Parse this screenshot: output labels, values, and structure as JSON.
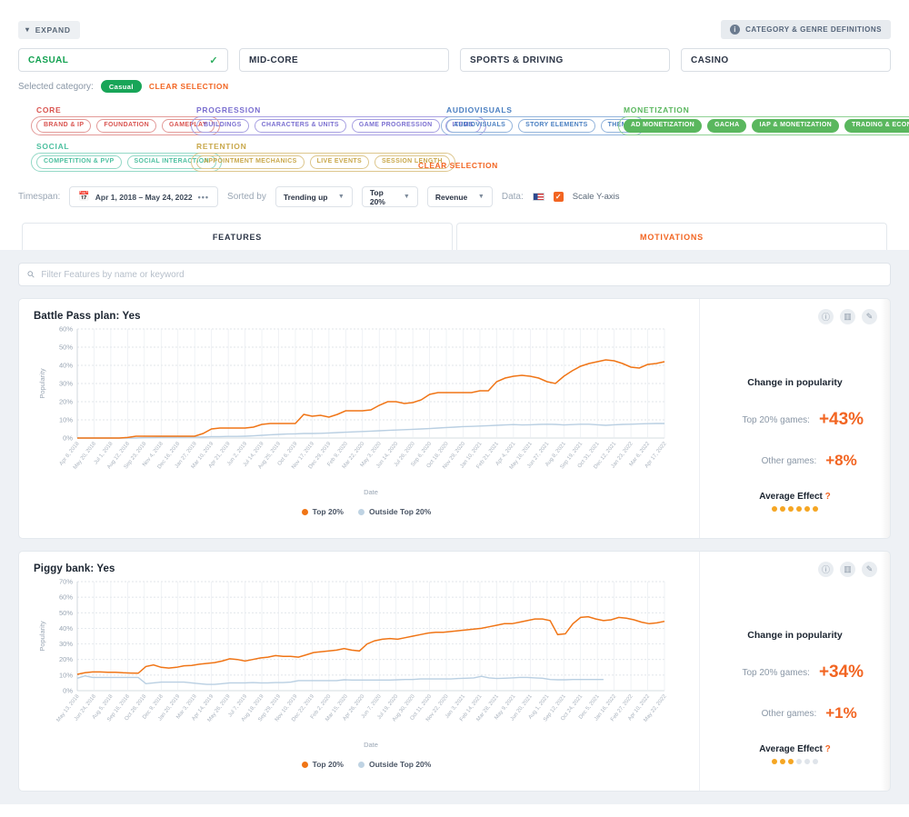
{
  "header": {
    "expand_label": "EXPAND",
    "definitions_label": "CATEGORY & GENRE DEFINITIONS",
    "info_icon": "info-icon",
    "chevron_icon": "chevron-down-icon"
  },
  "categories": [
    {
      "label": "CASUAL",
      "selected": true
    },
    {
      "label": "MID-CORE",
      "selected": false
    },
    {
      "label": "SPORTS & DRIVING",
      "selected": false
    },
    {
      "label": "CASINO",
      "selected": false
    }
  ],
  "selected_category": {
    "prefix": "Selected category:",
    "pill": "Casual",
    "clear": "CLEAR SELECTION"
  },
  "tag_groups": [
    {
      "title": "CORE",
      "color": "#d9534f",
      "klass": "g-core",
      "tags": [
        {
          "label": "BRAND & IP",
          "selected": false
        },
        {
          "label": "FOUNDATION",
          "selected": false
        },
        {
          "label": "GAMEPLAY",
          "selected": false
        }
      ]
    },
    {
      "title": "PROGRESSION",
      "color": "#7a6fd0",
      "klass": "g-prog",
      "tags": [
        {
          "label": "BUILDINGS",
          "selected": false
        },
        {
          "label": "CHARACTERS & UNITS",
          "selected": false
        },
        {
          "label": "GAME PROGRESSION",
          "selected": false
        },
        {
          "label": "ITEMS",
          "selected": false
        }
      ]
    },
    {
      "title": "AUDIOVISUALS",
      "color": "#4a7fc1",
      "klass": "g-av",
      "tags": [
        {
          "label": "AUDIOVISUALS",
          "selected": false
        },
        {
          "label": "STORY ELEMENTS",
          "selected": false
        },
        {
          "label": "THEME",
          "selected": false
        }
      ]
    },
    {
      "title": "MONETIZATION",
      "color": "#5ab75e",
      "klass": "g-mon",
      "tags": [
        {
          "label": "AD MONETIZATION",
          "selected": true
        },
        {
          "label": "GACHA",
          "selected": true
        },
        {
          "label": "IAP & MONETIZATION",
          "selected": true
        },
        {
          "label": "TRADING & ECONOMY",
          "selected": true
        }
      ]
    },
    {
      "title": "SOCIAL",
      "color": "#4ec0a0",
      "klass": "g-social",
      "tags": [
        {
          "label": "COMPETITION & PVP",
          "selected": false
        },
        {
          "label": "SOCIAL INTERACTION",
          "selected": false
        }
      ]
    },
    {
      "title": "RETENTION",
      "color": "#c9a84c",
      "klass": "g-ret",
      "tags": [
        {
          "label": "APPOINTMENT MECHANICS",
          "selected": false
        },
        {
          "label": "LIVE EVENTS",
          "selected": false
        },
        {
          "label": "SESSION LENGTH",
          "selected": false
        }
      ]
    }
  ],
  "tags_clear_label": "CLEAR SELECTION",
  "toolbar": {
    "timespan_label": "Timespan:",
    "timespan_value": "Apr 1, 2018  –  May 24, 2022",
    "timespan_more": "•••",
    "calendar_icon": "calendar-icon",
    "sorted_by_label": "Sorted by",
    "sort_value": "Trending up",
    "segment_value": "Top 20%",
    "metric_value": "Revenue",
    "data_label": "Data:",
    "data_flag": "us-flag-icon",
    "scale_y_label": "Scale Y-axis",
    "scale_y_checked": "✓"
  },
  "tabs": [
    {
      "label": "FEATURES",
      "active": true
    },
    {
      "label": "MOTIVATIONS",
      "active": false
    }
  ],
  "filter": {
    "placeholder": "Filter Features by name or keyword",
    "value": "",
    "icon": "search-icon"
  },
  "card_icons": [
    {
      "name": "info-icon",
      "glyph": "ⓘ"
    },
    {
      "name": "bar-chart-icon",
      "glyph": "▥"
    },
    {
      "name": "wrench-icon",
      "glyph": "✎"
    }
  ],
  "legend": [
    {
      "label": "Top 20%",
      "color": "#f07516"
    },
    {
      "label": "Outside Top 20%",
      "color": "#bfd3e3"
    }
  ],
  "cards": [
    {
      "title": "Battle Pass plan: Yes",
      "change_title": "Change in popularity",
      "top_label": "Top 20% games:",
      "top_value": "+43%",
      "other_label": "Other games:",
      "other_value": "+8%",
      "avg_label": "Average Effect",
      "avg_help": "?",
      "avg_dots_total": 6,
      "avg_dots_filled": 6
    },
    {
      "title": "Piggy bank: Yes",
      "change_title": "Change in popularity",
      "top_label": "Top 20% games:",
      "top_value": "+34%",
      "other_label": "Other games:",
      "other_value": "+1%",
      "avg_label": "Average Effect",
      "avg_help": "?",
      "avg_dots_total": 6,
      "avg_dots_filled": 3
    }
  ],
  "chart_data": [
    {
      "type": "line",
      "title": "Battle Pass plan: Yes",
      "xlabel": "Date",
      "ylabel": "Popularity",
      "ylim": [
        0,
        60
      ],
      "yticks": [
        "0%",
        "10%",
        "20%",
        "30%",
        "40%",
        "50%",
        "60%"
      ],
      "grid": true,
      "legend_position": "bottom",
      "x": [
        "Apr 8, 2018",
        "May 20, 2018",
        "Jul 1, 2018",
        "Aug 12, 2018",
        "Sep 23, 2018",
        "Nov 4, 2018",
        "Dec 16, 2018",
        "Jan 27, 2019",
        "Mar 10, 2019",
        "Apr 21, 2019",
        "Jun 2, 2019",
        "Jul 14, 2019",
        "Aug 25, 2019",
        "Oct 6, 2019",
        "Nov 17, 2019",
        "Dec 29, 2019",
        "Feb 9, 2020",
        "Mar 22, 2020",
        "May 3, 2020",
        "Jun 14, 2020",
        "Jul 26, 2020",
        "Sep 6, 2020",
        "Oct 18, 2020",
        "Nov 29, 2020",
        "Jan 10, 2021",
        "Feb 21, 2021",
        "Apr 4, 2021",
        "May 16, 2021",
        "Jun 27, 2021",
        "Aug 8, 2021",
        "Sep 19, 2021",
        "Oct 31, 2021",
        "Dec 12, 2021",
        "Jan 23, 2022",
        "Mar 6, 2022",
        "Apr 17, 2022"
      ],
      "series": [
        {
          "name": "Top 20%",
          "color": "#f07516",
          "values": [
            0,
            0,
            0,
            0,
            0,
            0,
            0.3,
            1,
            1,
            1,
            1,
            1,
            1,
            1,
            1,
            2.5,
            5,
            5.5,
            5.5,
            5.5,
            5.5,
            6,
            7.5,
            8,
            8,
            8,
            8,
            13,
            12,
            12.5,
            11.5,
            13,
            15,
            15,
            15,
            15.5,
            18,
            20,
            20,
            19,
            19.5,
            21,
            24,
            25,
            25,
            25,
            25,
            25,
            26,
            26,
            31,
            33,
            34,
            34.5,
            34,
            33,
            31,
            30,
            34,
            37,
            39.5,
            41,
            42,
            43,
            42.5,
            41,
            39,
            38.5,
            40.5,
            41,
            42
          ]
        },
        {
          "name": "Outside Top 20%",
          "color": "#bfd3e3",
          "values": [
            0,
            0,
            0,
            0,
            0,
            0,
            0,
            0,
            0.2,
            0.3,
            0.4,
            0.5,
            0.5,
            0.6,
            0.6,
            0.6,
            0.8,
            0.8,
            0.9,
            0.9,
            1,
            1.2,
            1.5,
            1.8,
            2,
            2.2,
            2.3,
            2.5,
            2.5,
            2.6,
            2.8,
            3,
            3.2,
            3.4,
            3.6,
            3.8,
            4,
            4.2,
            4.4,
            4.6,
            4.8,
            5,
            5.2,
            5.5,
            5.8,
            6,
            6.3,
            6.4,
            6.6,
            6.8,
            7,
            7.2,
            7.4,
            7.2,
            7.3,
            7.5,
            7.6,
            7.5,
            7.2,
            7.4,
            7.6,
            7.6,
            7.3,
            7.0,
            7.3,
            7.5,
            7.6,
            7.8,
            7.9,
            8,
            8
          ]
        }
      ]
    },
    {
      "type": "line",
      "title": "Piggy bank: Yes",
      "xlabel": "Date",
      "ylabel": "Popularity",
      "ylim": [
        0,
        70
      ],
      "yticks": [
        "0%",
        "10%",
        "20%",
        "30%",
        "40%",
        "50%",
        "60%",
        "70%"
      ],
      "grid": true,
      "legend_position": "bottom",
      "x": [
        "May 13, 2018",
        "Jun 24, 2018",
        "Aug 5, 2018",
        "Sep 16, 2018",
        "Oct 28, 2018",
        "Dec 9, 2018",
        "Jan 20, 2019",
        "Mar 3, 2019",
        "Apr 14, 2019",
        "May 26, 2019",
        "Jul 7, 2019",
        "Aug 18, 2019",
        "Sep 29, 2019",
        "Nov 10, 2019",
        "Dec 22, 2019",
        "Feb 2, 2020",
        "Mar 15, 2020",
        "Apr 26, 2020",
        "Jun 7, 2020",
        "Jul 19, 2020",
        "Aug 30, 2020",
        "Oct 11, 2020",
        "Nov 22, 2020",
        "Jan 3, 2021",
        "Feb 14, 2021",
        "Mar 28, 2021",
        "May 9, 2021",
        "Jun 20, 2021",
        "Aug 1, 2021",
        "Sep 12, 2021",
        "Oct 24, 2021",
        "Dec 5, 2021",
        "Jan 16, 2022",
        "Feb 27, 2022",
        "Apr 10, 2022",
        "May 22, 2022"
      ],
      "series": [
        {
          "name": "Top 20%",
          "color": "#f07516",
          "values": [
            10.5,
            11.5,
            12,
            12,
            11.8,
            11.8,
            11.5,
            11.3,
            11.2,
            15.5,
            16.5,
            15,
            14.5,
            15,
            16,
            16.2,
            17,
            17.5,
            18,
            19,
            20.5,
            20,
            19,
            20,
            21,
            21.5,
            22.5,
            22,
            22,
            21.5,
            23,
            24.5,
            25,
            25.5,
            26,
            27,
            26,
            25.5,
            30,
            32,
            33,
            33.5,
            33,
            34,
            35,
            36,
            37,
            37.5,
            37.5,
            38,
            38.5,
            39,
            39.5,
            40,
            41,
            42,
            43,
            43,
            44,
            45,
            46,
            46,
            45,
            36,
            36.5,
            43,
            47,
            47.5,
            46,
            45,
            45.5,
            47,
            46.5,
            45.5,
            44,
            43,
            43.5,
            44.5
          ]
        },
        {
          "name": "Outside Top 20%",
          "color": "#bfd3e3",
          "values": [
            8,
            9.5,
            8.5,
            8.5,
            8.5,
            8.5,
            8.5,
            8.5,
            8.5,
            4.5,
            5,
            5.5,
            5.5,
            5.5,
            5.5,
            5,
            4.5,
            4,
            4,
            4.5,
            5,
            5,
            5,
            5.2,
            5,
            5,
            5.2,
            5.2,
            5.5,
            6.5,
            6.5,
            6.5,
            6.5,
            6.5,
            6.5,
            7,
            6.8,
            6.8,
            6.8,
            6.8,
            6.8,
            6.8,
            7,
            7.2,
            7.2,
            7.5,
            7.5,
            7.5,
            7.5,
            7.5,
            7.8,
            8,
            8.2,
            9.2,
            8.2,
            7.8,
            8,
            8.2,
            8.5,
            8.5,
            8.2,
            8,
            7.2,
            7,
            7,
            7.2,
            7.2,
            7.2,
            7.2,
            7.2
          ]
        }
      ]
    }
  ]
}
